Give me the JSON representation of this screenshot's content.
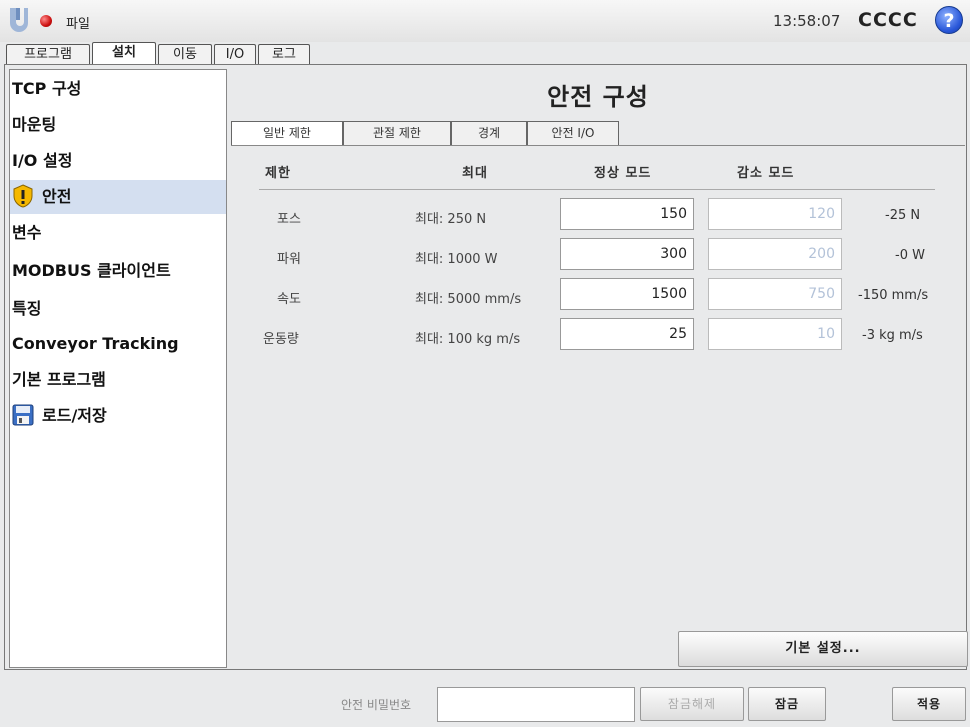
{
  "header": {
    "file_label": "파일",
    "time": "13:58:07",
    "robot_name": "CCCC",
    "help_symbol": "?"
  },
  "main_tabs": [
    {
      "label": "프로그램",
      "active": false
    },
    {
      "label": "설치",
      "active": true
    },
    {
      "label": "이동",
      "active": false
    },
    {
      "label": "I/O",
      "active": false
    },
    {
      "label": "로그",
      "active": false
    }
  ],
  "sidebar": {
    "items": [
      {
        "label": "TCP 구성",
        "icon": null,
        "selected": false
      },
      {
        "label": "마운팅",
        "icon": null,
        "selected": false
      },
      {
        "label": "I/O 설정",
        "icon": null,
        "selected": false
      },
      {
        "label": "안전",
        "icon": "warning-icon",
        "selected": true
      },
      {
        "label": "변수",
        "icon": null,
        "selected": false
      },
      {
        "label": "MODBUS 클라이언트",
        "icon": null,
        "selected": false
      },
      {
        "label": "특징",
        "icon": null,
        "selected": false
      },
      {
        "label": "Conveyor Tracking",
        "icon": null,
        "selected": false
      },
      {
        "label": "기본 프로그램",
        "icon": null,
        "selected": false
      },
      {
        "label": "로드/저장",
        "icon": "floppy-disk-icon",
        "selected": false
      }
    ]
  },
  "page": {
    "title": "안전 구성"
  },
  "sub_tabs": [
    {
      "label": "일반 제한",
      "active": true
    },
    {
      "label": "관절 제한",
      "active": false
    },
    {
      "label": "경계",
      "active": false
    },
    {
      "label": "안전 I/O",
      "active": false
    }
  ],
  "limits_table": {
    "headers": {
      "limit": "제한",
      "max": "최대",
      "normal": "정상 모드",
      "reduced": "감소 모드"
    },
    "rows": [
      {
        "name": "포스",
        "max": "최대: 250 N",
        "normal": "150",
        "reduced": "120",
        "diff": "-25 N"
      },
      {
        "name": "파워",
        "max": "최대: 1000 W",
        "normal": "300",
        "reduced": "200",
        "diff": "-0 W"
      },
      {
        "name": "속도",
        "max": "최대: 5000 mm/s",
        "normal": "1500",
        "reduced": "750",
        "diff": "-150 mm/s"
      },
      {
        "name": "운동량",
        "max": "최대: 100 kg m/s",
        "normal": "25",
        "reduced": "10",
        "diff": "-3 kg m/s"
      }
    ]
  },
  "buttons": {
    "default_settings": "기본 설정..."
  },
  "footer": {
    "password_label": "안전 비밀번호",
    "password_value": "",
    "unlock_label": "잠금해제",
    "lock_label": "잠금",
    "apply_label": "적용"
  },
  "colors": {
    "selected_bg": "#d4dff0",
    "disabled_text": "#b3c2d8",
    "status_dot": "#cc1010",
    "help_blue": "#2856d8"
  }
}
